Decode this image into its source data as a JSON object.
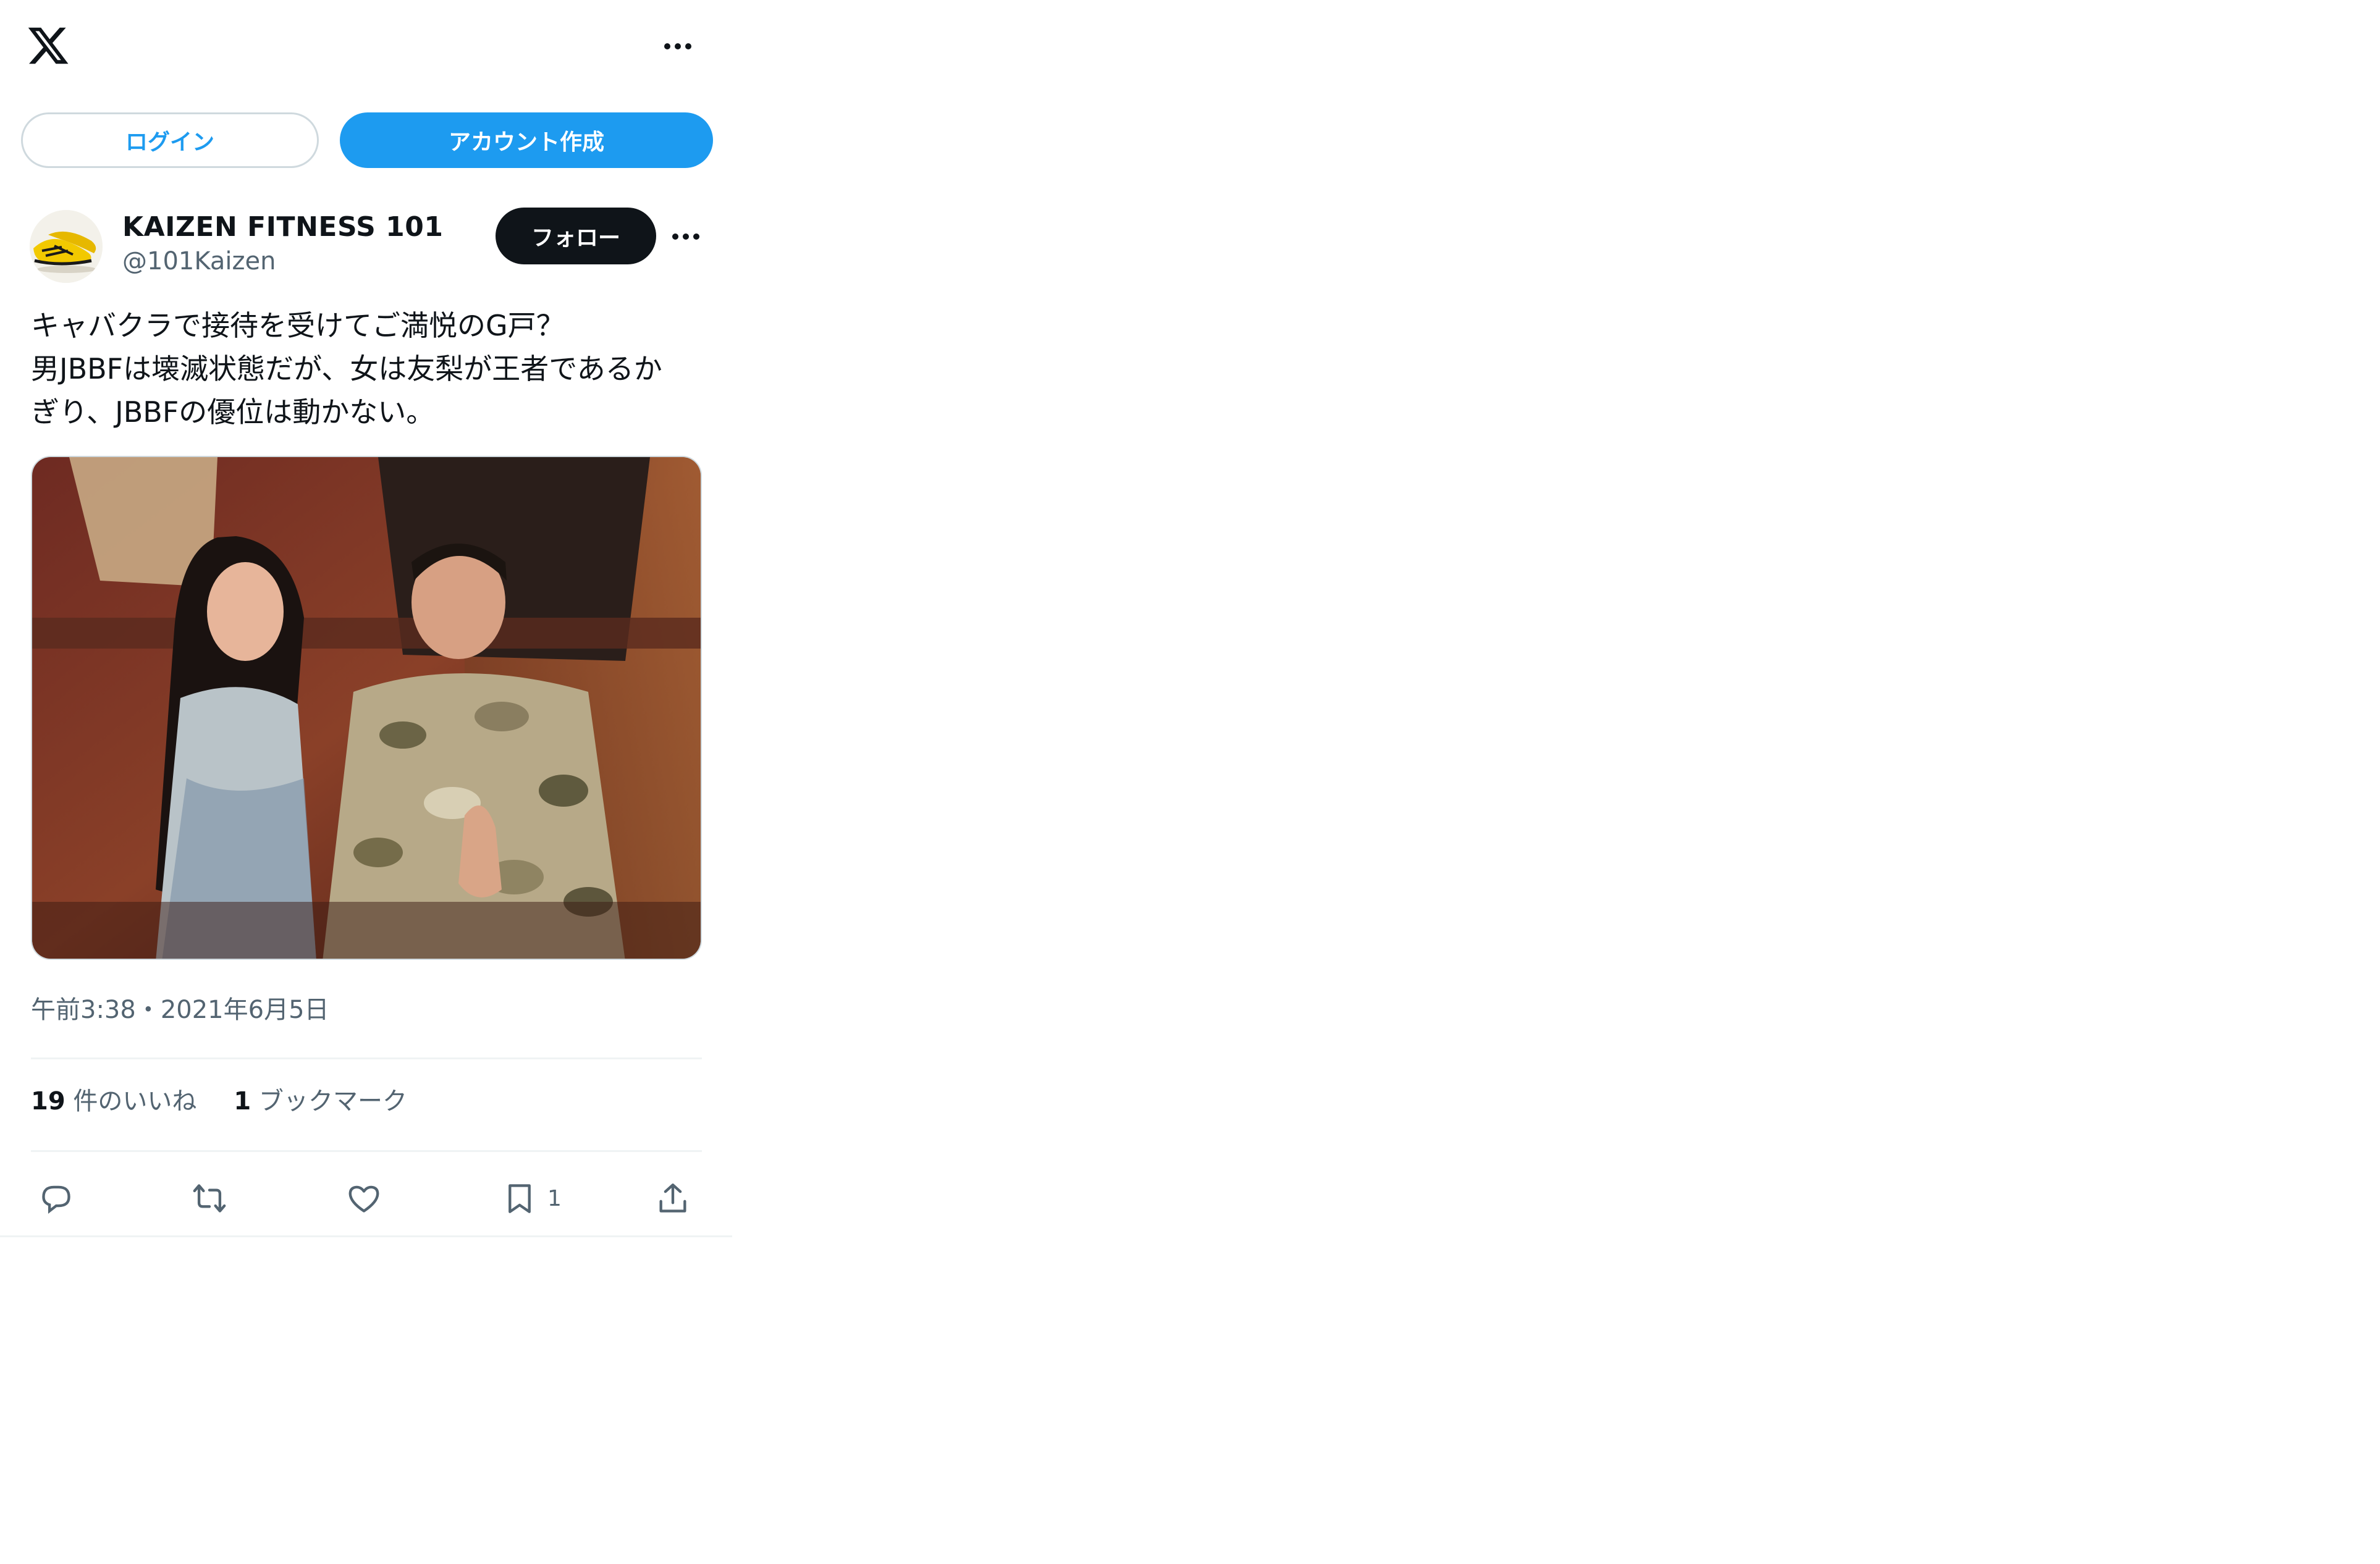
{
  "colors": {
    "accent": "#1d9bf0",
    "text_primary": "#0f1419",
    "text_secondary": "#536471",
    "divider": "#eff3f4",
    "follow_bg": "#0f1419"
  },
  "header": {
    "logo_icon": "x-logo-icon",
    "more_icon": "more-horizontal-icon"
  },
  "auth": {
    "login_label": "ログイン",
    "signup_label": "アカウント作成"
  },
  "tweet": {
    "author": {
      "display_name": "KAIZEN FITNESS 101",
      "handle": "@101Kaizen",
      "avatar_icon": "yellow-sneakers-avatar"
    },
    "follow_label": "フォロー",
    "text_lines": [
      "キャバクラで接待を受けてご満悦のG戸？",
      "男JBBFは壊滅状態だが、女は友梨が王者であるか",
      "ぎり、JBBFの優位は動かない。"
    ],
    "media_icon": "photo-two-people-thumbs-up",
    "timestamp": "午前3:38・2021年6月5日",
    "stats": {
      "likes_count": "19",
      "likes_label": "件のいいね",
      "bookmarks_count": "1",
      "bookmarks_label": "ブックマーク"
    },
    "actions": {
      "reply_icon": "reply-icon",
      "retweet_icon": "retweet-icon",
      "like_icon": "heart-icon",
      "bookmark_icon": "bookmark-icon",
      "bookmark_count": "1",
      "share_icon": "share-icon"
    }
  }
}
